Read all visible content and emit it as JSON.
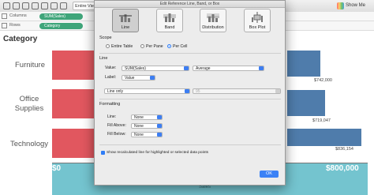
{
  "toolbar": {
    "entire_view": "Entire View",
    "show_me": "Show Me"
  },
  "shelves": {
    "columns": {
      "label": "Columns",
      "pill": "SUM(Sales)"
    },
    "rows": {
      "label": "Rows",
      "pill": "Category"
    }
  },
  "view": {
    "header": "Category",
    "categories": [
      {
        "label": "Furniture",
        "value_label": "$742,000"
      },
      {
        "label": "Office Supplies",
        "value_label": "$719,047"
      },
      {
        "label": "Technology",
        "value_label": "$836,154"
      }
    ],
    "axis": {
      "min_label": "$0",
      "max_label": "$800,000",
      "title_fragment": "Sales"
    }
  },
  "dialog": {
    "title": "Edit Reference Line, Band, or Box",
    "types": [
      "Line",
      "Band",
      "Distribution",
      "Box Plot"
    ],
    "selected_type": "Line",
    "scope": {
      "label": "Scope",
      "options": [
        "Entire Table",
        "Per Pane",
        "Per Cell"
      ],
      "selected": "Per Cell"
    },
    "line": {
      "section_label": "Line",
      "value_label": "Value:",
      "value_field": "SUM(Sales)",
      "aggregation": "Average",
      "label_label": "Label:",
      "label_value": "Value",
      "line_type": "Line only",
      "percent": "95"
    },
    "formatting": {
      "section_label": "Formatting",
      "line_label": "Line:",
      "line_value": "None",
      "fill_above_label": "Fill Above:",
      "fill_above_value": "None",
      "fill_below_label": "Fill Below:",
      "fill_below_value": "None"
    },
    "recalc_label": "Show recalculated line for highlighted or selected data points",
    "ok": "OK"
  },
  "colors": {
    "bar_red": "#e1575f",
    "bar_blue": "#4f7cab",
    "axis_band": "#74c4cf",
    "pill_green": "#3fa57a",
    "accent_blue": "#2f7df6"
  }
}
